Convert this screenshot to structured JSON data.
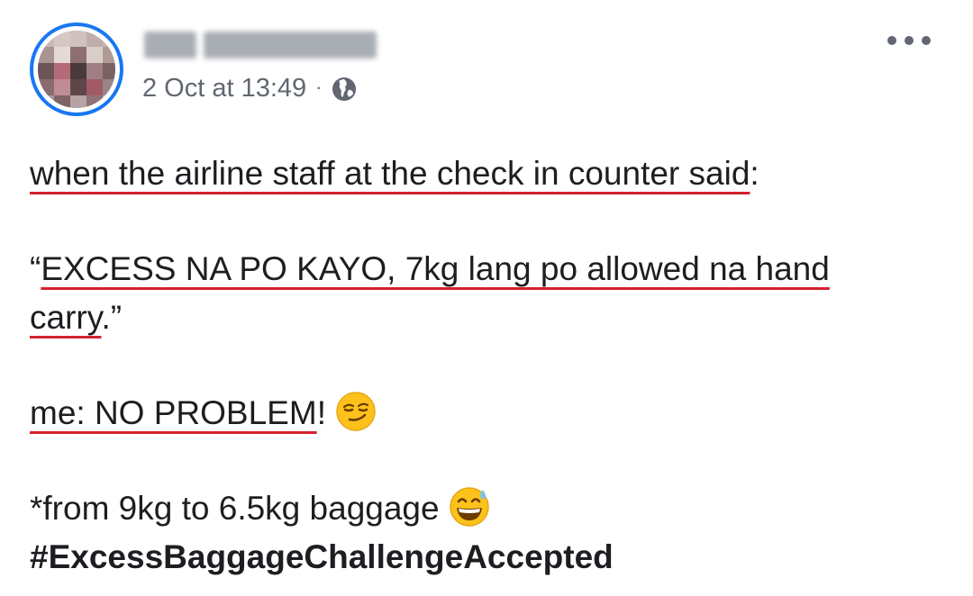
{
  "post": {
    "author_name": "",
    "timestamp": "2 Oct at 13:49",
    "separator": "·",
    "privacy_icon": "globe-icon",
    "more_icon": "more-horizontal-icon",
    "lines": {
      "l1_main": "when the airline staff at the check in counter said",
      "l1_tail": ":",
      "l2_open": "“",
      "l2_main": "EXCESS NA PO KAYO, 7kg lang po allowed na hand",
      "l3_main": "carry",
      "l3_tail": ".”",
      "l4_main": "me: NO PROBLEM",
      "l4_tail": "!",
      "l4_emoji": "smirking-face-emoji",
      "l5_main": "*from 9kg to 6.5kg baggage",
      "l5_emoji": "grinning-face-with-sweat-emoji",
      "hashtag": "#ExcessBaggageChallengeAccepted"
    },
    "colors": {
      "text": "#1c1e21",
      "meta": "#606770",
      "avatar_ring": "#1877f2",
      "spellcheck_underline": "#d3232f"
    }
  }
}
